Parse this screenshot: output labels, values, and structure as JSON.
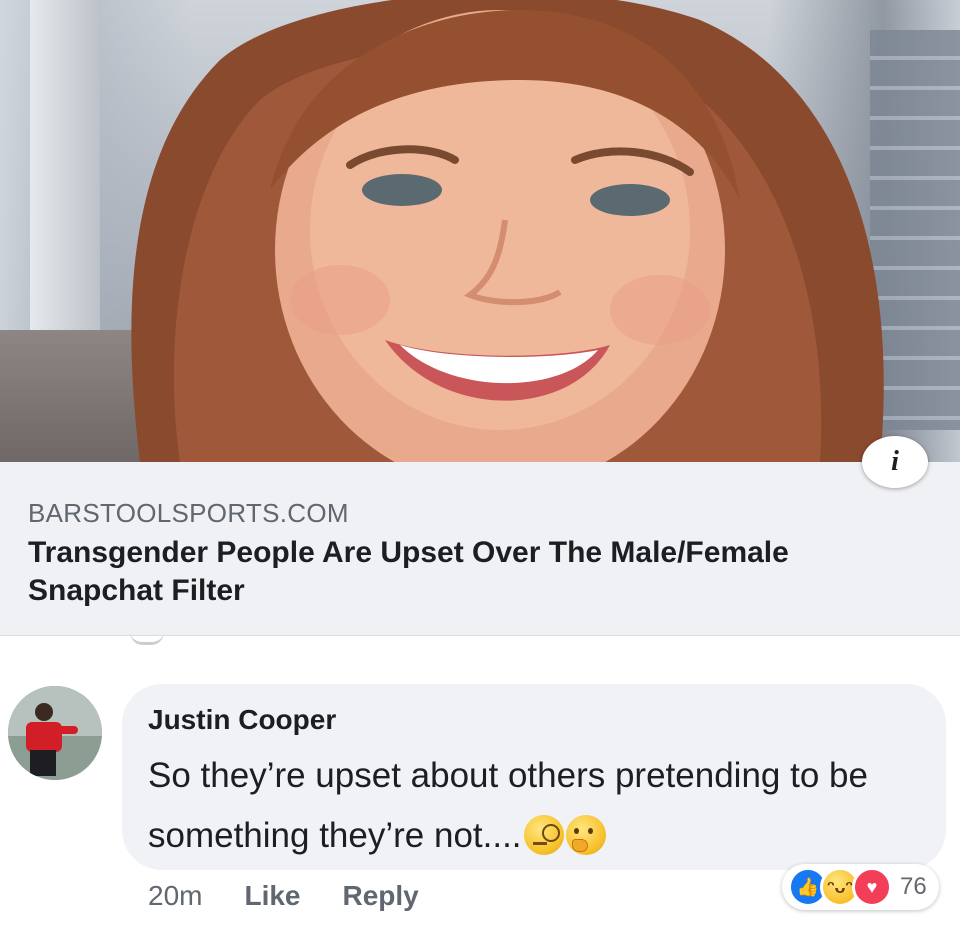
{
  "link_preview": {
    "domain": "BARSTOOLSPORTS.COM",
    "headline": "Transgender People Are Upset Over The Male/Female Snapchat Filter",
    "info_glyph": "i"
  },
  "comment": {
    "author": "Justin Cooper",
    "text": "So they’re upset about others pretending to be something they’re not....",
    "emojis": [
      "face-with-monocle",
      "thinking-face"
    ],
    "timestamp": "20m",
    "like_label": "Like",
    "reply_label": "Reply",
    "reactions": {
      "icons": [
        "like-icon",
        "haha-icon",
        "love-icon"
      ],
      "count": "76"
    }
  }
}
